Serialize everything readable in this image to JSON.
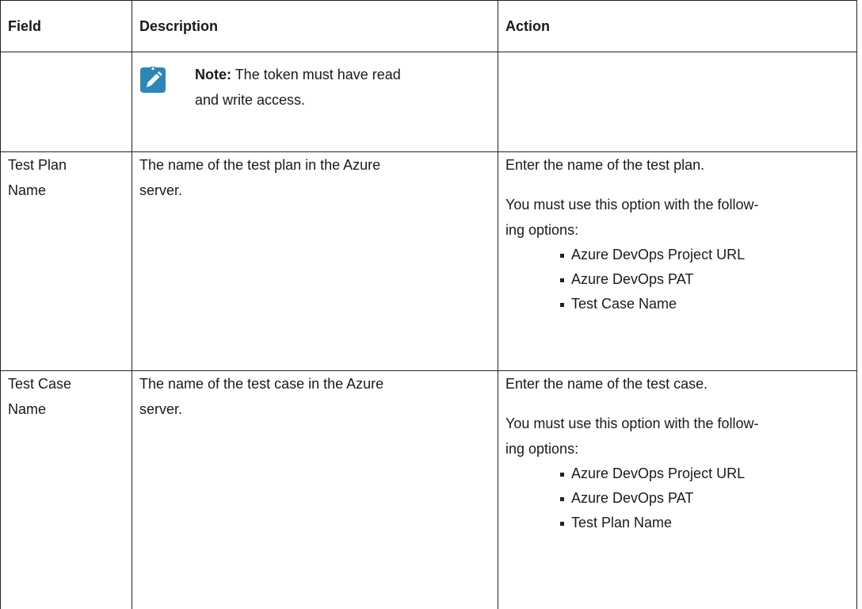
{
  "table": {
    "headers": {
      "field": "Field",
      "description": "Description",
      "action": "Action"
    },
    "note_row": {
      "note_label": "Note:",
      "note_text_line1": "The token must have read",
      "note_text_line2": "and write access."
    },
    "rows": [
      {
        "field_line1": "Test Plan",
        "field_line2": "Name",
        "description_line1": "The name of the test plan in the Azure",
        "description_line2": "server.",
        "action_first": "Enter the name of the test plan.",
        "action_second_line1": "You must use this option with the follow-",
        "action_second_line2": "ing options:",
        "options": [
          "Azure DevOps Project URL",
          "Azure DevOps PAT",
          "Test Case Name"
        ]
      },
      {
        "field_line1": "Test Case",
        "field_line2": "Name",
        "description_line1": "The name of the test case in the Azure",
        "description_line2": "server.",
        "action_first": "Enter the name of the test case.",
        "action_second_line1": "You must use this option with the follow-",
        "action_second_line2": "ing options:",
        "options": [
          "Azure DevOps Project URL",
          "Azure DevOps PAT",
          "Test Plan Name"
        ]
      }
    ]
  },
  "colors": {
    "note_icon_bg": "#2a87b8",
    "border": "#222222",
    "text": "#1a1a1a"
  },
  "icons": {
    "note": "pencil-note-icon"
  }
}
